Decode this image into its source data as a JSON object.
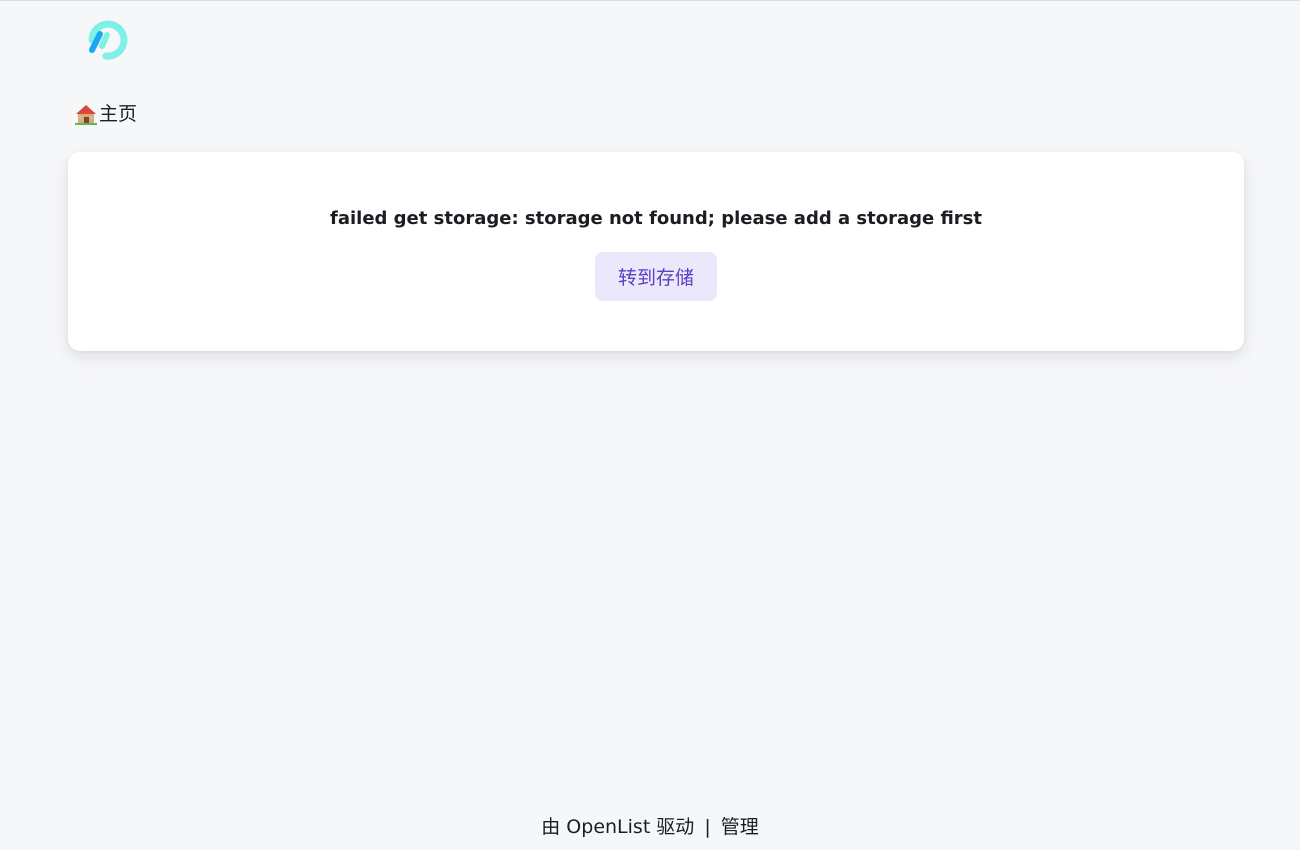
{
  "header": {
    "logo_icon": "openlist-logo-icon"
  },
  "breadcrumb": {
    "home_icon": "house-icon",
    "home_label": "主页"
  },
  "error": {
    "message": "failed get storage: storage not found; please add a storage first",
    "button_label": "转到存储"
  },
  "footer": {
    "powered_by": "由 OpenList 驱动",
    "separator": "|",
    "manage_label": "管理"
  },
  "colors": {
    "background": "#f6f7f9",
    "card": "#ffffff",
    "button_bg": "#ece8fb",
    "button_text": "#5b3fc4",
    "logo_teal": "#7ff0e6",
    "logo_blue": "#1aa8f0"
  }
}
